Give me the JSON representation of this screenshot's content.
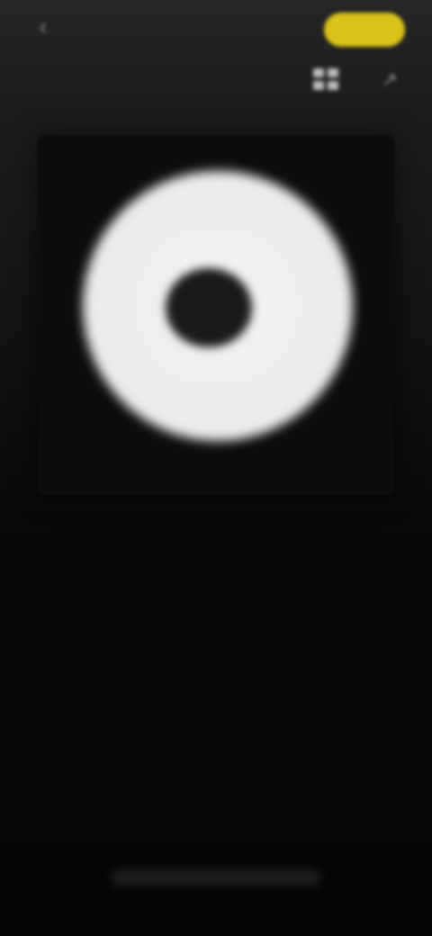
{
  "top_bar": {
    "back_icon": "back-arrow-icon",
    "title": "",
    "premium_label": ""
  },
  "toolbar": {
    "mode_label": "",
    "grid_icon": "grid-icon",
    "share_icon": "share-icon"
  },
  "preview": {
    "disc_line_1": "",
    "disc_line_2": "",
    "disc_side_label": ""
  },
  "colors": {
    "accent": "#d9c21a",
    "background": "#050505",
    "disc": "#f0f0f0"
  }
}
